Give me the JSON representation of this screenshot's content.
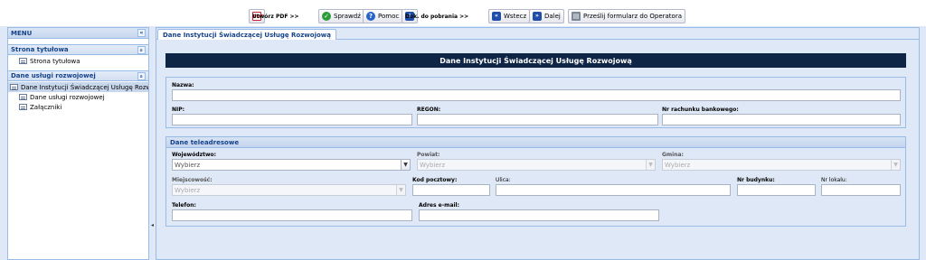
{
  "toolbar": {
    "create_pdf": "Utwórz PDF >>",
    "check": "Sprawdź",
    "help": "Pomoc",
    "download": "Dok. do pobrania >>",
    "back": "Wstecz",
    "next": "Dalej",
    "send": "Prześlij formularz do Operatora"
  },
  "sidebar": {
    "title": "MENU",
    "collapse_glyph": "«",
    "groups": [
      {
        "title": "Strona tytułowa",
        "toggle_glyph": "»",
        "items": [
          {
            "label": "Strona tytułowa"
          }
        ]
      },
      {
        "title": "Dane usługi rozwojowej",
        "toggle_glyph": "»",
        "items": [
          {
            "label": "Dane Instytucji Świadczącej Usługę Rozwojową"
          },
          {
            "label": "Dane usługi rozwojowej"
          },
          {
            "label": "Załączniki"
          }
        ]
      }
    ]
  },
  "main": {
    "tab_label": "Dane Instytucji Świadczącej Usługę Rozwojową",
    "form_title": "Dane Instytucji Świadczącej Usługę Rozwojową",
    "fields": {
      "nazwa_label": "Nazwa:",
      "nip_label": "NIP:",
      "regon_label": "REGON:",
      "account_label": "Nr rachunku bankowego:"
    },
    "contact": {
      "legend": "Dane teleadresowe",
      "voivodeship_label": "Województwo:",
      "voivodeship_value": "Wybierz",
      "county_label": "Powiat:",
      "county_value": "Wybierz",
      "commune_label": "Gmina:",
      "commune_value": "Wybierz",
      "city_label": "Miejscowość:",
      "city_value": "Wybierz",
      "postal_label": "Kod pocztowy:",
      "street_label": "Ulica:",
      "building_label": "Nr budynku:",
      "apartment_label": "Nr lokalu:",
      "phone_label": "Telefon:",
      "email_label": "Adres e-mail:"
    }
  }
}
